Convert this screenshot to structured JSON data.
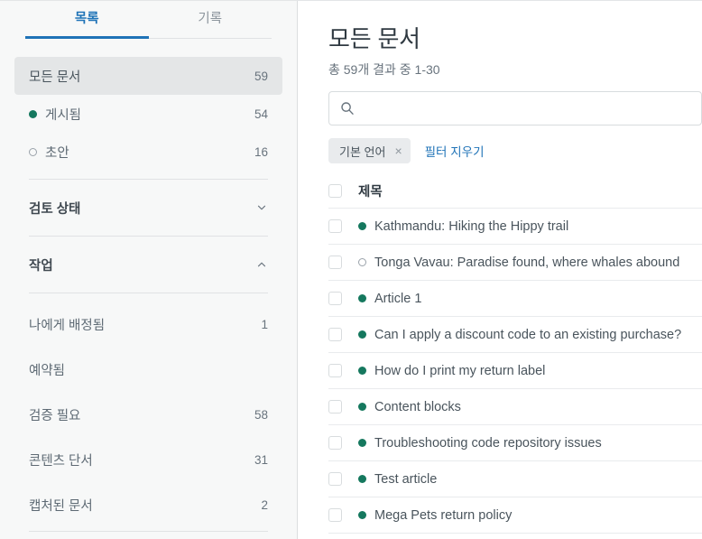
{
  "sidebar": {
    "tabs": [
      {
        "label": "목록",
        "active": true
      },
      {
        "label": "기록",
        "active": false
      }
    ],
    "primary_items": [
      {
        "label": "모든 문서",
        "count": "59",
        "status": "none",
        "selected": true
      },
      {
        "label": "게시됨",
        "count": "54",
        "status": "published",
        "selected": false
      },
      {
        "label": "초안",
        "count": "16",
        "status": "draft",
        "selected": false
      }
    ],
    "sections": [
      {
        "label": "검토 상태",
        "expanded": false,
        "chevron": "chevron-down-icon",
        "items": []
      },
      {
        "label": "작업",
        "expanded": true,
        "chevron": "chevron-up-icon",
        "items": [
          {
            "label": "나에게 배정됨",
            "count": "1"
          },
          {
            "label": "예약됨",
            "count": ""
          },
          {
            "label": "검증 필요",
            "count": "58"
          },
          {
            "label": "콘텐츠 단서",
            "count": "31"
          },
          {
            "label": "캡처된 문서",
            "count": "2"
          }
        ]
      }
    ]
  },
  "main": {
    "title": "모든 문서",
    "result_summary": "총 59개 결과 중 1-30",
    "search": {
      "icon": "search-icon",
      "value": "",
      "placeholder": ""
    },
    "filters": {
      "chip_label": "기본 언어",
      "chip_close_glyph": "×",
      "clear_label": "필터 지우기"
    },
    "table": {
      "column_header": "제목",
      "rows": [
        {
          "title": "Kathmandu: Hiking the Hippy trail",
          "status": "published",
          "checked": false
        },
        {
          "title": "Tonga Vavau: Paradise found, where whales abound",
          "status": "draft",
          "checked": false
        },
        {
          "title": "Article 1",
          "status": "published",
          "checked": false
        },
        {
          "title": "Can I apply a discount code to an existing purchase?",
          "status": "published",
          "checked": false
        },
        {
          "title": "How do I print my return label",
          "status": "published",
          "checked": false
        },
        {
          "title": "Content blocks",
          "status": "published",
          "checked": false
        },
        {
          "title": "Troubleshooting code repository issues",
          "status": "published",
          "checked": false
        },
        {
          "title": "Test article",
          "status": "published",
          "checked": false
        },
        {
          "title": "Mega Pets return policy",
          "status": "published",
          "checked": false
        }
      ]
    }
  },
  "colors": {
    "accent_blue": "#1f73b7",
    "published_green": "#15785e",
    "draft_gray": "#9aa2aa",
    "sidebar_bg": "#f7f8f8",
    "selected_bg": "#e4e6e7",
    "chip_bg": "#e9ebed",
    "text_primary": "#2f3941",
    "text_secondary": "#68737d"
  }
}
